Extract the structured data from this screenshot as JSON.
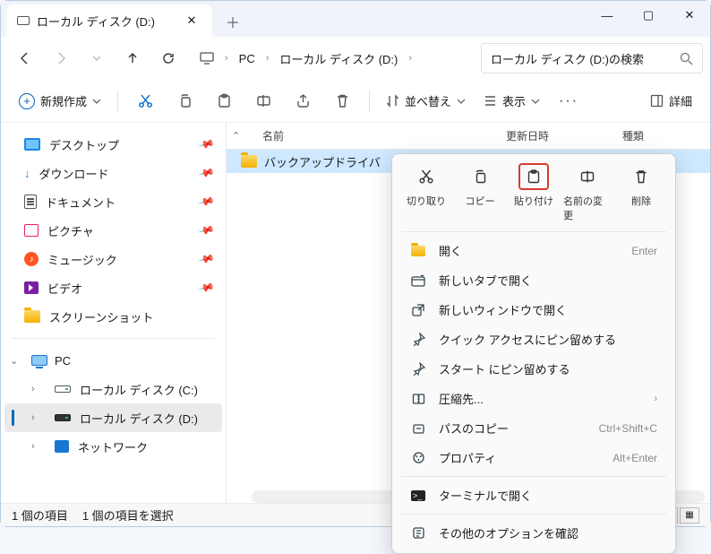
{
  "titlebar": {
    "tab_title": "ローカル ディスク (D:)",
    "tab_close": "✕",
    "newtab": "＋",
    "min": "—",
    "max": "▢",
    "close": "✕"
  },
  "nav": {
    "crumb_pc": "PC",
    "crumb_drive": "ローカル ディスク (D:)"
  },
  "search": {
    "placeholder": "ローカル ディスク (D:)の検索"
  },
  "toolbar": {
    "new": "新規作成",
    "sort": "並べ替え",
    "view": "表示",
    "details": "詳細"
  },
  "sidebar": {
    "desktop": "デスクトップ",
    "downloads": "ダウンロード",
    "documents": "ドキュメント",
    "pictures": "ピクチャ",
    "music": "ミュージック",
    "videos": "ビデオ",
    "screenshots": "スクリーンショット",
    "pc": "PC",
    "disk_c": "ローカル ディスク (C:)",
    "disk_d": "ローカル ディスク (D:)",
    "network": "ネットワーク"
  },
  "columns": {
    "name": "名前",
    "date": "更新日時",
    "type": "種類"
  },
  "files": {
    "row0": "バックアップドライバ"
  },
  "status": {
    "count": "1 個の項目",
    "selected": "1 個の項目を選択"
  },
  "ctx": {
    "cut": "切り取り",
    "copy": "コピー",
    "paste": "貼り付け",
    "rename": "名前の変更",
    "delete": "削除",
    "open": "開く",
    "open_sc": "Enter",
    "newtab": "新しいタブで開く",
    "newwin": "新しいウィンドウで開く",
    "pin_quick": "クイック アクセスにピン留めする",
    "pin_start": "スタート にピン留めする",
    "compress": "圧縮先...",
    "copypath": "パスのコピー",
    "copypath_sc": "Ctrl+Shift+C",
    "properties": "プロパティ",
    "properties_sc": "Alt+Enter",
    "terminal": "ターミナルで開く",
    "more": "その他のオプションを確認"
  }
}
